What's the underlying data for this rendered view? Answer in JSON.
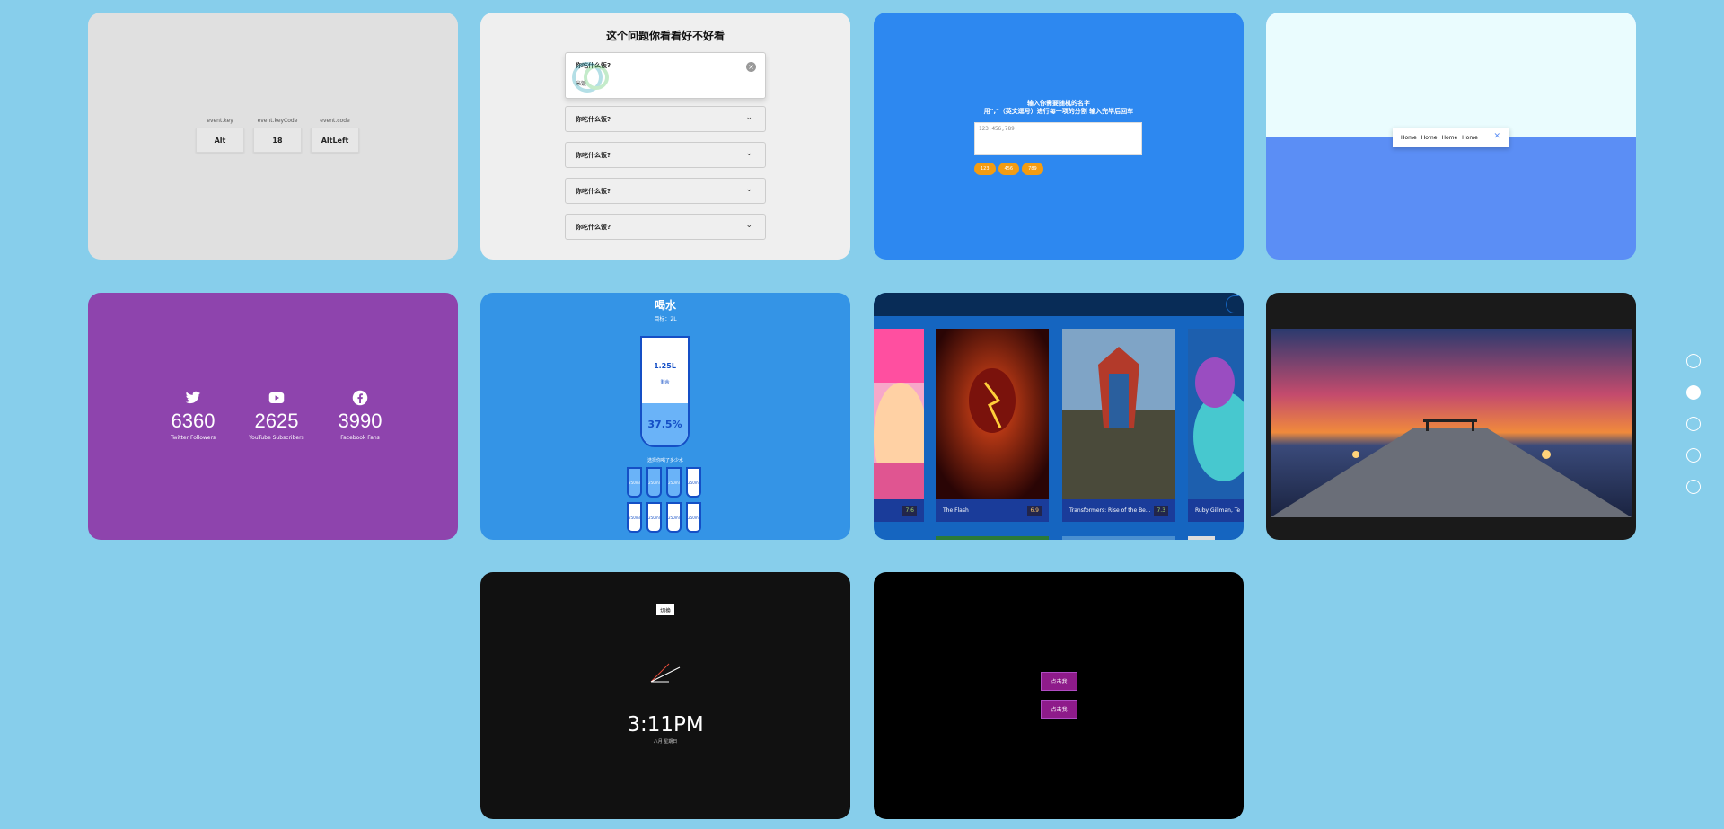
{
  "key_card": {
    "columns": [
      {
        "label": "event.key",
        "value": "Alt"
      },
      {
        "label": "event.keyCode",
        "value": "18"
      },
      {
        "label": "event.code",
        "value": "AltLeft"
      }
    ]
  },
  "faq_card": {
    "title": "这个问题你看看好不好看",
    "open_question": "你吃什么饭?",
    "open_answer": "米饭",
    "questions": [
      "你吃什么饭?",
      "你吃什么饭?",
      "你吃什么饭?",
      "你吃什么饭?"
    ]
  },
  "picker_card": {
    "heading1": "输入你需要随机的名字",
    "heading2": "用\",\"（英文逗号）进行每一项的分割 输入完毕后回车",
    "textarea_value": "123,456,789",
    "tags": [
      "123",
      "456",
      "789"
    ]
  },
  "nav_card": {
    "links": [
      "Home",
      "Home",
      "Home",
      "Home"
    ],
    "close_icon": "close-icon"
  },
  "counter_card": {
    "counters": [
      {
        "icon": "twitter-icon",
        "value": "6360",
        "label": "Twitter Followers"
      },
      {
        "icon": "youtube-icon",
        "value": "2625",
        "label": "YouTube Subscribers"
      },
      {
        "icon": "facebook-icon",
        "value": "3990",
        "label": "Facebook Fans"
      }
    ]
  },
  "water_card": {
    "title": "喝水",
    "goal": "目标：2L",
    "remained": "1.25L",
    "remained_label": "剩余",
    "percentage": "37.5%",
    "fill_fraction": 0.375,
    "select_text": "选择你喝了多少水",
    "cups": [
      "250ml",
      "250ml",
      "250ml",
      "250ml",
      "250ml",
      "250ml",
      "250ml",
      "250ml"
    ],
    "cups_full": 3
  },
  "movie_card": {
    "movies": [
      {
        "title": "",
        "rating": "7.6",
        "rating_color": "green"
      },
      {
        "title": "The Flash",
        "rating": "6.9",
        "rating_color": "orange"
      },
      {
        "title": "Transformers: Rise of the Be...",
        "rating": "7.3",
        "rating_color": "green"
      },
      {
        "title": "Ruby Gillman, Te",
        "rating": "",
        "rating_color": "green"
      }
    ]
  },
  "clock_card": {
    "toggle_label": "切换",
    "time": "3:11PM",
    "date": "八月 星期日"
  },
  "button_card": {
    "button1": "点击我",
    "button2": "点击我"
  },
  "pagination": {
    "count": 5,
    "active_index": 1
  },
  "colors": {
    "page_background": "#87ceeb",
    "water_blue": "#144fc6",
    "counter_purple": "#8e44ad",
    "button_purple": "#8e1b8a"
  }
}
